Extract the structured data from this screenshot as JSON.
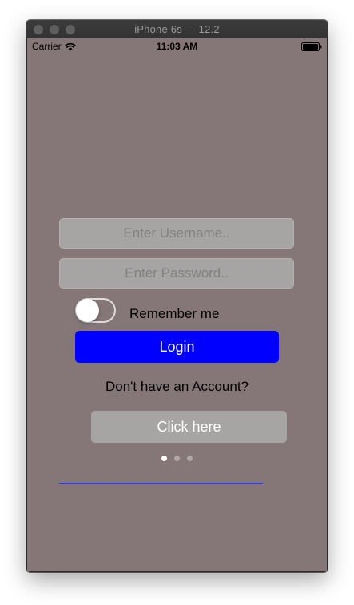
{
  "window": {
    "title": "iPhone 6s — 12.2"
  },
  "status_bar": {
    "carrier": "Carrier",
    "time": "11:03 AM"
  },
  "login_form": {
    "username_placeholder": "Enter Username..",
    "password_placeholder": "Enter Password..",
    "remember_me_label": "Remember me",
    "remember_me_on": false,
    "login_label": "Login",
    "signup_prompt": "Don't have an Account?",
    "click_here_label": "Click here"
  },
  "page_control": {
    "count": 3,
    "current": 1
  },
  "colors": {
    "background": "#857778",
    "login_button": "#0000ff",
    "field": "#a7a4a4",
    "underline": "#1f3cff"
  }
}
